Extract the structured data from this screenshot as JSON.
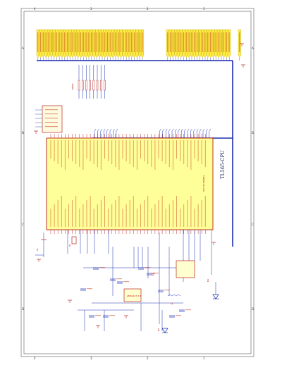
{
  "sheet": {
    "title": "TL565-CPU",
    "chip_name": "STC12C5A60S2",
    "col_markers": [
      "4",
      "3",
      "2",
      "1"
    ],
    "row_markers": [
      "A",
      "B",
      "C",
      "D"
    ]
  },
  "components": {
    "reset_switch": "S1",
    "crystal": "X1",
    "regulator": "AMS1117-3.3",
    "led": "D1",
    "diode": "D2",
    "inductor": "L1"
  }
}
